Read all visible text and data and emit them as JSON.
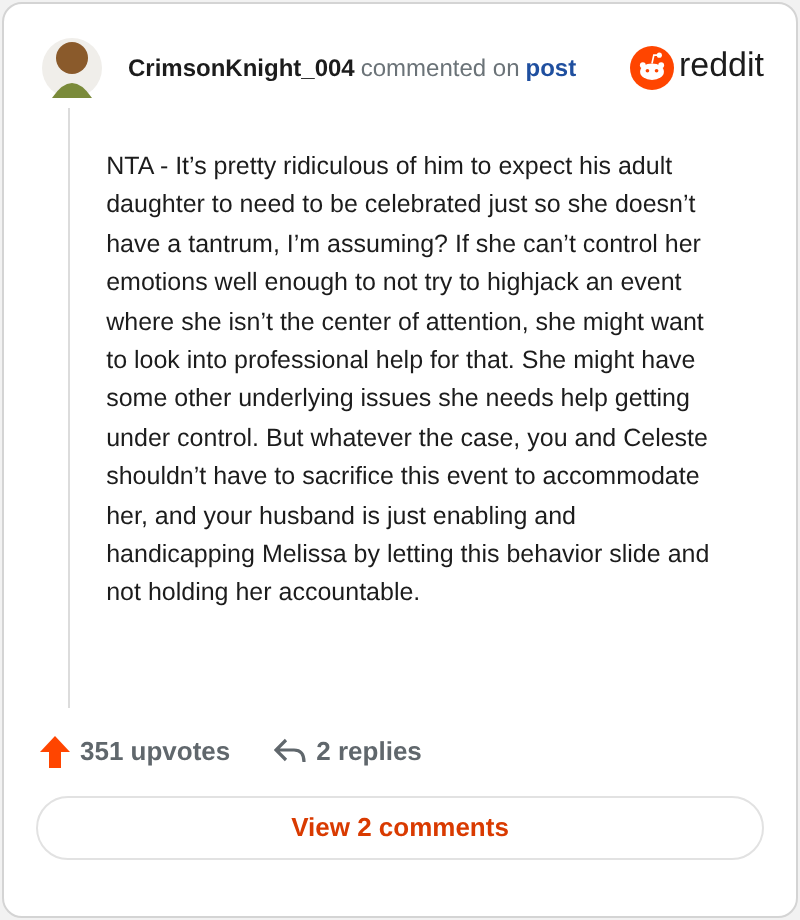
{
  "comment": {
    "author": "CrimsonKnight_004",
    "action": "commented on",
    "target": "post",
    "brand": "reddit",
    "body": "NTA - It’s pretty ridiculous of him to expect his adult daughter to need to be celebrated just so she doesn’t have a tantrum, I’m assuming? If she can’t control her emotions well enough to not try to highjack an event where she isn’t the center of attention, she might want to look into professional help for that. She might have some other underlying issues she needs help getting under control. But whatever the case, you and Celeste shouldn’t have to sacrifice this event to accommodate her, and your husband is just enabling and handicapping Melissa by letting this behavior slide and not holding her accountable.",
    "upvotes": "351 upvotes",
    "replies": "2 replies"
  },
  "button": "View 2 comments"
}
